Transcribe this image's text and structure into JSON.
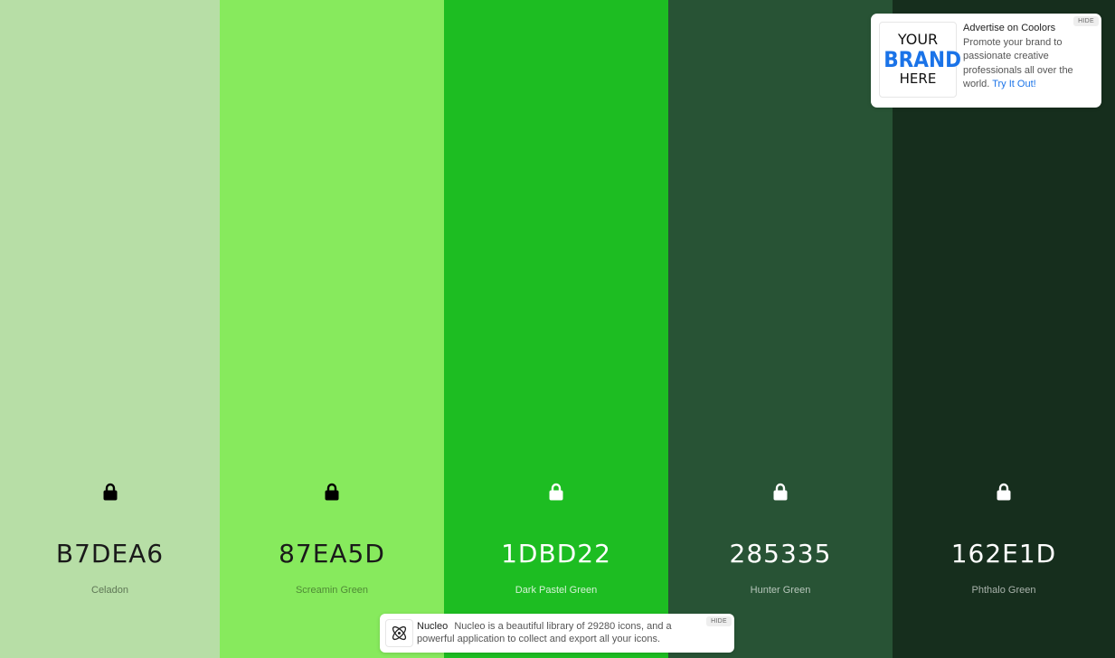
{
  "swatches": [
    {
      "hex": "B7DEA6",
      "name": "Celadon",
      "bg": "#B7DEA6",
      "fg": "#1a1a1a",
      "name_color": "#5f7756",
      "lock_color": "#000000"
    },
    {
      "hex": "87EA5D",
      "name": "Screamin Green",
      "bg": "#87EA5D",
      "fg": "#1a1a1a",
      "name_color": "#4f8a36",
      "lock_color": "#000000"
    },
    {
      "hex": "1DBD22",
      "name": "Dark Pastel Green",
      "bg": "#1DBD22",
      "fg": "#ffffff",
      "name_color": "#d6f3d7",
      "lock_color": "#ffffff"
    },
    {
      "hex": "285335",
      "name": "Hunter Green",
      "bg": "#285335",
      "fg": "#ffffff",
      "name_color": "#b7c6bb",
      "lock_color": "#ffffff"
    },
    {
      "hex": "162E1D",
      "name": "Phthalo Green",
      "bg": "#162E1D",
      "fg": "#ffffff",
      "name_color": "#a9b3ac",
      "lock_color": "#ffffff"
    }
  ],
  "ad": {
    "logo_line1": "YOUR",
    "logo_line2": "BRAND",
    "logo_line3": "HERE",
    "title": "Advertise on Coolors",
    "body": "Promote your brand to passionate creative professionals all over the world.",
    "link": "Try It Out!",
    "hide": "HIDE"
  },
  "ad2": {
    "title": "Nucleo",
    "body": "Nucleo is a beautiful library of 29280 icons, and a powerful application to collect and export all your icons.",
    "hide": "HIDE",
    "icon": "atom-icon"
  },
  "icons": {
    "lock": "lock-icon"
  }
}
